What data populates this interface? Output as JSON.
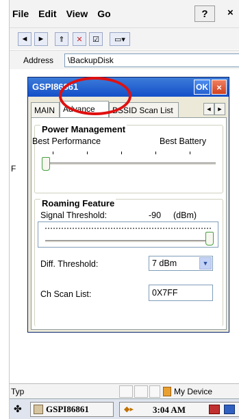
{
  "menu": {
    "items": [
      "File",
      "Edit",
      "View",
      "Go"
    ],
    "help_glyph": "?",
    "close_glyph": "×"
  },
  "toolbar": {
    "buttons": [
      {
        "icon": "back-arrow-icon",
        "glyph": "◄"
      },
      {
        "icon": "forward-arrow-icon",
        "glyph": "►"
      },
      {
        "icon": "up-folder-icon",
        "glyph": "⇑"
      },
      {
        "icon": "delete-icon",
        "glyph": "✕"
      },
      {
        "icon": "properties-icon",
        "glyph": "☑"
      },
      {
        "icon": "views-icon",
        "glyph": "▭▾"
      }
    ]
  },
  "address": {
    "label": "Address",
    "value": "\\BackupDisk"
  },
  "background": {
    "partial_letter": "F"
  },
  "dialog": {
    "title": "GSPI86861",
    "ok_label": "OK",
    "close_glyph": "×",
    "tabs": [
      {
        "label": "MAIN"
      },
      {
        "label": "Advance",
        "selected": true
      },
      {
        "label": "BSSID Scan List"
      }
    ],
    "tab_scroll": {
      "left": "◄",
      "right": "►"
    },
    "power": {
      "title": "Power Management",
      "left_label": "Best Performance",
      "right_label": "Best Battery",
      "level": 0
    },
    "roaming": {
      "title": "Roaming Feature",
      "signal_label": "Signal Threshold:",
      "signal_value": "-90",
      "signal_unit": "(dBm)",
      "signal_level": 1,
      "diff_label": "Diff. Threshold:",
      "diff_value": "7 dBm",
      "scan_label": "Ch Scan List:",
      "scan_value": "0X7FF"
    }
  },
  "statusbar": {
    "left_text": "Typ",
    "device_label": "My Device"
  },
  "taskbar": {
    "task_label": "GSPI86861",
    "time": "3:04 AM"
  },
  "colors": {
    "highlight_circle": "#e01010",
    "title_bar": "#1450c8",
    "slider_thumb_border": "#44a040"
  }
}
